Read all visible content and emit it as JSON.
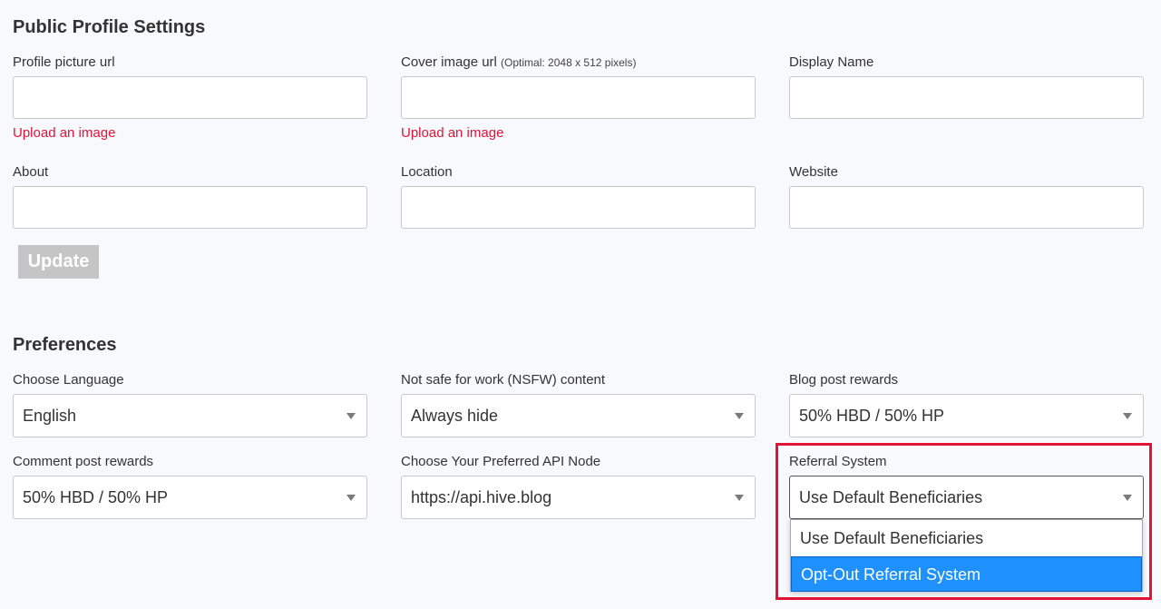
{
  "public_profile": {
    "title": "Public Profile Settings",
    "profile_picture": {
      "label": "Profile picture url",
      "value": "",
      "upload_label": "Upload an image"
    },
    "cover_image": {
      "label": "Cover image url",
      "hint": "(Optimal: 2048 x 512 pixels)",
      "value": "",
      "upload_label": "Upload an image"
    },
    "display_name": {
      "label": "Display Name",
      "value": ""
    },
    "about": {
      "label": "About",
      "value": ""
    },
    "location": {
      "label": "Location",
      "value": ""
    },
    "website": {
      "label": "Website",
      "value": ""
    },
    "update_button": "Update"
  },
  "preferences": {
    "title": "Preferences",
    "language": {
      "label": "Choose Language",
      "selected": "English"
    },
    "nsfw": {
      "label": "Not safe for work (NSFW) content",
      "selected": "Always hide"
    },
    "blog_rewards": {
      "label": "Blog post rewards",
      "selected": "50% HBD / 50% HP"
    },
    "comment_rewards": {
      "label": "Comment post rewards",
      "selected": "50% HBD / 50% HP"
    },
    "api_node": {
      "label": "Choose Your Preferred API Node",
      "selected": "https://api.hive.blog"
    },
    "referral": {
      "label": "Referral System",
      "selected": "Use Default Beneficiaries",
      "options": [
        "Use Default Beneficiaries",
        "Opt-Out Referral System"
      ],
      "highlighted_option": "Opt-Out Referral System"
    }
  },
  "colors": {
    "accent_red": "#e31337",
    "option_highlight": "#1e90ff",
    "disabled_button": "#c5c5c5",
    "background": "#f8f9fd"
  }
}
